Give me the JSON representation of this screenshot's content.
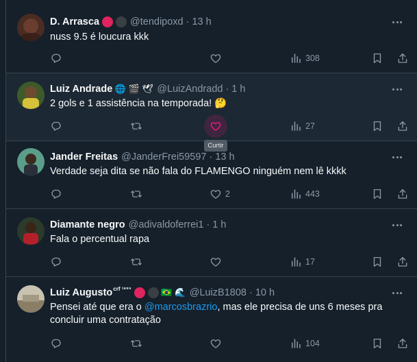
{
  "tweets": [
    {
      "name": "D. Arrasca",
      "handle": "@tendipoxd",
      "time": "13 h",
      "text": "nuss 9.5 é loucura kkk",
      "counts": {
        "reply": "",
        "retweet": "",
        "like": "",
        "views": "308"
      },
      "icons": [
        "reply-icon",
        "like-icon",
        "views-icon",
        "bookmark-icon",
        "share-icon"
      ]
    },
    {
      "name": "Luiz Andrade",
      "handle": "@LuizAndradd",
      "time": "1 h",
      "text": "2 gols e 1 assistência na temporada!",
      "text_emoji": "🤔",
      "badge_emojis": [
        "🌐",
        "🎬",
        "🕊"
      ],
      "counts": {
        "reply": "",
        "retweet": "",
        "like": "",
        "views": "27"
      },
      "like_hovered": true
    },
    {
      "name": "Jander Freitas",
      "handle": "@JanderFrei59597",
      "time": "13 h",
      "text": "Verdade seja dita se não fala do FLAMENGO ninguém nem lê kkkk",
      "counts": {
        "reply": "",
        "retweet": "",
        "like": "2",
        "views": "443"
      }
    },
    {
      "name": "Diamante negro",
      "handle": "@adivaldoferrei1",
      "time": "1 h",
      "text": "Fala o percentual rapa",
      "counts": {
        "reply": "",
        "retweet": "",
        "like": "",
        "views": "17"
      }
    },
    {
      "name": "Luiz Augusto",
      "name_sup": "crf ¹⁸⁹⁵",
      "handle": "@LuizB1808",
      "time": "10 h",
      "text_before": "Pensei até que era o ",
      "mention": "@marcosbrazrio",
      "text_after": ", mas ele precisa de uns 6 meses pra concluir uma contratação",
      "badge_emojis": [
        "🇧🇷",
        "🌊"
      ],
      "counts": {
        "reply": "",
        "retweet": "",
        "like": "",
        "views": "104"
      }
    }
  ],
  "tooltip": "Curtir",
  "separator": "·",
  "colors": {
    "background": "#15202b",
    "hover_background": "#1c2833",
    "text": "#f7f9f9",
    "muted": "#8b98a5",
    "accent": "#1d9bf0",
    "like_pink": "#f91880",
    "badge_red": "#e0245e"
  }
}
